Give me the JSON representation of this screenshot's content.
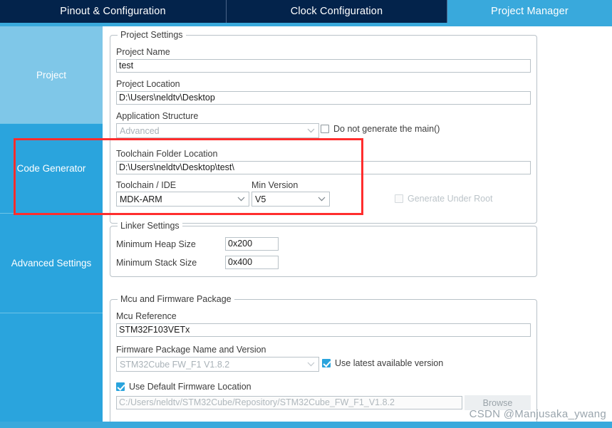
{
  "tabs": [
    {
      "label": "Pinout & Configuration",
      "active": false
    },
    {
      "label": "Clock Configuration",
      "active": false
    },
    {
      "label": "Project Manager",
      "active": true
    }
  ],
  "sidebar": {
    "items": [
      {
        "label": "Project",
        "selected": true
      },
      {
        "label": "Code Generator",
        "selected": false
      },
      {
        "label": "Advanced Settings",
        "selected": false
      },
      {
        "label": "",
        "selected": false
      }
    ]
  },
  "project_settings": {
    "legend": "Project Settings",
    "project_name_label": "Project Name",
    "project_name_value": "test",
    "project_location_label": "Project Location",
    "project_location_value": "D:\\Users\\neldtv\\Desktop",
    "application_structure_label": "Application Structure",
    "application_structure_value": "Advanced",
    "do_not_generate_main_label": "Do not generate the main()",
    "do_not_generate_main_checked": false,
    "toolchain_folder_label": "Toolchain Folder Location",
    "toolchain_folder_value": "D:\\Users\\neldtv\\Desktop\\test\\",
    "toolchain_ide_label": "Toolchain / IDE",
    "toolchain_ide_value": "MDK-ARM",
    "min_version_label": "Min Version",
    "min_version_value": "V5",
    "generate_under_root_label": "Generate Under Root",
    "generate_under_root_checked": false
  },
  "linker_settings": {
    "legend": "Linker Settings",
    "heap_label": "Minimum Heap Size",
    "heap_value": "0x200",
    "stack_label": "Minimum Stack Size",
    "stack_value": "0x400"
  },
  "mcu_firmware": {
    "legend": "Mcu and Firmware Package",
    "mcu_reference_label": "Mcu Reference",
    "mcu_reference_value": "STM32F103VETx",
    "firmware_package_label": "Firmware Package Name and Version",
    "firmware_package_value": "STM32Cube FW_F1 V1.8.2",
    "use_latest_label": "Use latest available version",
    "use_latest_checked": true,
    "use_default_location_label": "Use Default Firmware Location",
    "use_default_location_checked": true,
    "firmware_location_value": "C:/Users/neldtv/STM32Cube/Repository/STM32Cube_FW_F1_V1.8.2",
    "browse_label": "Browse"
  },
  "annotation": {
    "highlight_color": "#ff2d2d"
  },
  "watermark": {
    "text": "CSDN @Manjusaka_ywang"
  },
  "colors": {
    "tab_bar": "#03234b",
    "accent": "#39a9dc",
    "sidebar": "#2aa4dd",
    "sidebar_selected": "#7fc7e8"
  }
}
